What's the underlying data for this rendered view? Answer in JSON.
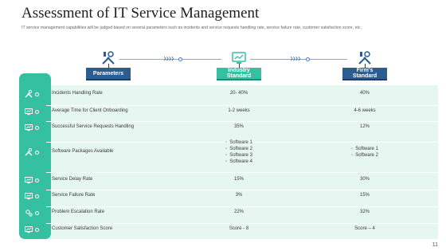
{
  "slide": {
    "title": "Assessment of IT Service Management",
    "subtitle": "IT service management capabilities will be judged based on several parameters such as incidents and service requests handling rate, service failure rate, customer satisfaction score, etc.",
    "page_number": "11"
  },
  "header": {
    "parameters": "Parameters",
    "industry_standard": "Industry Standard",
    "firms_standard": "Firm's Standard",
    "icons": [
      "tools-icon",
      "monitor-icon",
      "tools-icon"
    ]
  },
  "colors": {
    "teal": "#35c0a2",
    "navy": "#2d5c91",
    "panel": "#e6f6f1"
  },
  "rows": [
    {
      "icon": "wrench-icon",
      "label": "Incidents Handling Rate",
      "industry": "20- 40%",
      "firm": "40%"
    },
    {
      "icon": "monitor-icon",
      "label": "Average Time for Client Onboarding",
      "industry": "1-2 weeks",
      "firm": "4-6 weeks"
    },
    {
      "icon": "monitor-icon",
      "label": "Successful Service Requests Handling",
      "industry": "35%",
      "firm": "12%"
    },
    {
      "icon": "wrench-icon",
      "label": "Software Packages Available",
      "industry_list": [
        "Software 1",
        "Software 2",
        "Software 3",
        "Software 4"
      ],
      "firm_list": [
        "Software 1",
        "Software 2"
      ]
    },
    {
      "icon": "monitor-icon",
      "label": "Service Delay Rate",
      "industry": "15%",
      "firm": "30%"
    },
    {
      "icon": "monitor-icon",
      "label": "Service Failure Rate",
      "industry": "3%",
      "firm": "15%"
    },
    {
      "icon": "gears-icon",
      "label": "Problem Escalation Rate",
      "industry": "22%",
      "firm": "32%"
    },
    {
      "icon": "monitor-icon",
      "label": "Customer Satisfaction Score",
      "industry": "Score - 8",
      "firm": "Score – 4"
    }
  ]
}
